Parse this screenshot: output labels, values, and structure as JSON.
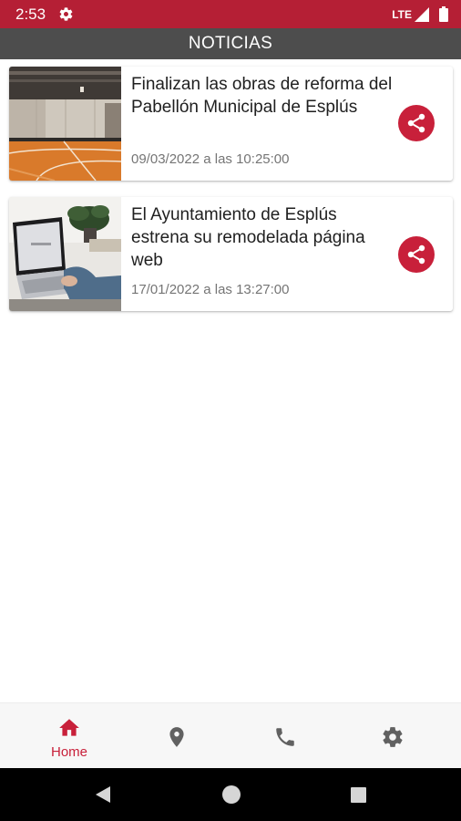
{
  "status_bar": {
    "time": "2:53",
    "network": "LTE"
  },
  "app_bar": {
    "title": "NOTICIAS"
  },
  "news": [
    {
      "title": "Finalizan las obras de reforma del Pabellón Municipal de Esplús",
      "date": "09/03/2022 a las 10:25:00",
      "image": "sports-hall-photo"
    },
    {
      "title": "El Ayuntamiento de Esplús estrena su remodelada página web",
      "date": "17/01/2022 a las 13:27:00",
      "image": "laptop-photo"
    }
  ],
  "bottom_nav": {
    "items": [
      {
        "label": "Home",
        "icon": "home-icon",
        "active": true
      },
      {
        "label": "",
        "icon": "location-pin-icon",
        "active": false
      },
      {
        "label": "",
        "icon": "phone-icon",
        "active": false
      },
      {
        "label": "",
        "icon": "settings-icon",
        "active": false
      }
    ]
  },
  "colors": {
    "status_bar": "#b51f35",
    "app_bar": "#4d4d4d",
    "accent": "#c8203a",
    "nav_inactive": "#616161"
  }
}
